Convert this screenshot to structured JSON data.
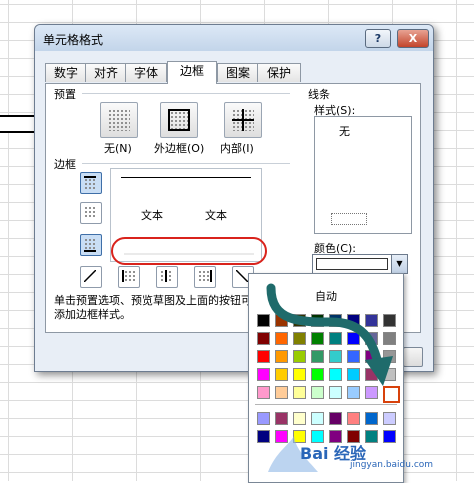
{
  "dialog": {
    "title": "单元格格式",
    "help_label": "?",
    "close_label": "X"
  },
  "tabs": [
    "数字",
    "对齐",
    "字体",
    "边框",
    "图案",
    "保护"
  ],
  "active_tab": "边框",
  "presets": {
    "section_label": "预置",
    "items": [
      {
        "label": "无(N)",
        "icon": "border-none-icon"
      },
      {
        "label": "外边框(O)",
        "icon": "border-outline-icon"
      },
      {
        "label": "内部(I)",
        "icon": "border-inside-icon"
      }
    ]
  },
  "border": {
    "section_label": "边框",
    "preview_texts": [
      "文本",
      "文本"
    ]
  },
  "line": {
    "section_label": "线条",
    "style_label": "样式(S):",
    "style_none": "无",
    "color_label": "颜色(C):"
  },
  "help_text": "单击预置选项、预览草图及上面的按钮可以添加边框样式。",
  "palette": {
    "auto_label": "自动",
    "rows": [
      [
        "#000000",
        "#993300",
        "#333300",
        "#003300",
        "#003366",
        "#000080",
        "#333399",
        "#333333"
      ],
      [
        "#800000",
        "#ff6600",
        "#808000",
        "#008000",
        "#008080",
        "#0000ff",
        "#666699",
        "#808080"
      ],
      [
        "#ff0000",
        "#ff9900",
        "#99cc00",
        "#339966",
        "#33cccc",
        "#3366ff",
        "#800080",
        "#969696"
      ],
      [
        "#ff00ff",
        "#ffcc00",
        "#ffff00",
        "#00ff00",
        "#00ffff",
        "#00ccff",
        "#993366",
        "#c0c0c0"
      ],
      [
        "#ff99cc",
        "#ffcc99",
        "#ffff99",
        "#ccffcc",
        "#ccffff",
        "#99ccff",
        "#cc99ff",
        "#ffffff"
      ]
    ],
    "extra_rows": [
      [
        "#9999ff",
        "#993366",
        "#ffffcc",
        "#ccffff",
        "#660066",
        "#ff8080",
        "#0066cc",
        "#ccccff"
      ],
      [
        "#000080",
        "#ff00ff",
        "#ffff00",
        "#00ffff",
        "#800080",
        "#800000",
        "#008080",
        "#0000ff"
      ]
    ],
    "selected": "#ffffff"
  },
  "watermark": {
    "brand": "Bai 经验",
    "url": "jingyan.baidu.com"
  },
  "colors": {
    "title_bg": "#c9d9ee",
    "highlight": "#d9231c",
    "arrow": "#1f6b6b"
  }
}
